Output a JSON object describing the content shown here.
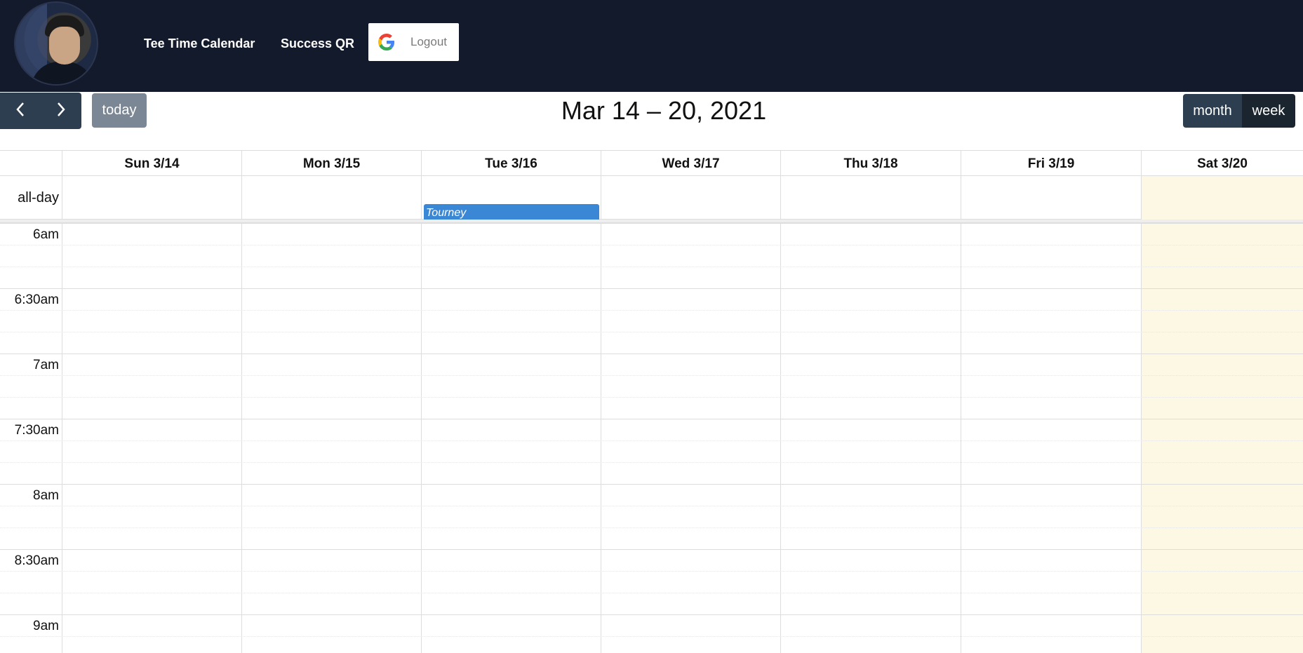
{
  "navbar": {
    "links": [
      "Tee Time Calendar",
      "Success QR"
    ],
    "logout_label": "Logout"
  },
  "toolbar": {
    "prev_icon": "‹",
    "next_icon": "›",
    "today_label": "today",
    "title": "Mar 14 – 20, 2021",
    "views": [
      "month",
      "week"
    ],
    "active_view": "week"
  },
  "calendar": {
    "days": [
      "Sun 3/14",
      "Mon 3/15",
      "Tue 3/16",
      "Wed 3/17",
      "Thu 3/18",
      "Fri 3/19",
      "Sat 3/20"
    ],
    "highlighted_day": "Sat 3/20",
    "allday_label": "all-day",
    "allday_events": [
      {
        "day": "Tue 3/16",
        "title": "Tourney",
        "color": "#3a87d5"
      }
    ],
    "time_labels": [
      "6am",
      "6:30am",
      "7am",
      "7:30am",
      "8am",
      "8:30am",
      "9am"
    ]
  },
  "colors": {
    "navbar_bg": "#131a2b",
    "button_bg": "#2c3e50",
    "today_highlight": "#fcf8e3",
    "event": "#3a87d5"
  }
}
